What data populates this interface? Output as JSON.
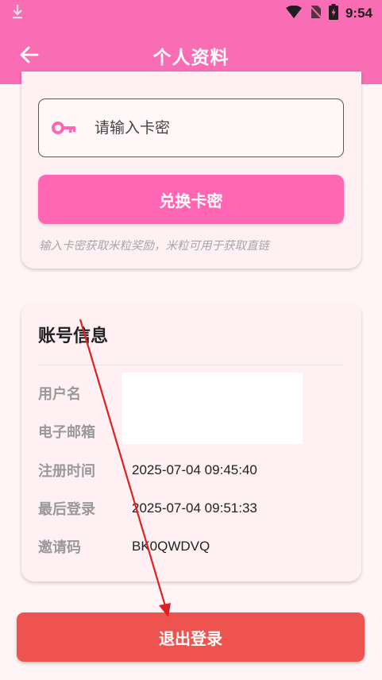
{
  "status_bar": {
    "time": "9:54"
  },
  "app_bar": {
    "title": "个人资料"
  },
  "redeem": {
    "placeholder": "请输入卡密",
    "button_label": "兑换卡密",
    "hint": "输入卡密获取米粒奖励，米粒可用于获取直链"
  },
  "account": {
    "title": "账号信息",
    "rows": [
      {
        "label": "用户名",
        "value": ""
      },
      {
        "label": "电子邮箱",
        "value": ""
      },
      {
        "label": "注册时间",
        "value": "2025-07-04 09:45:40"
      },
      {
        "label": "最后登录",
        "value": "2025-07-04 09:51:33"
      },
      {
        "label": "邀请码",
        "value": "BK0QWDVQ"
      }
    ]
  },
  "logout": {
    "label": "退出登录"
  },
  "colors": {
    "header": "#f86db3",
    "accent": "#ff67b4",
    "logout": "#ef5350",
    "annotation_arrow": "#e02020"
  }
}
